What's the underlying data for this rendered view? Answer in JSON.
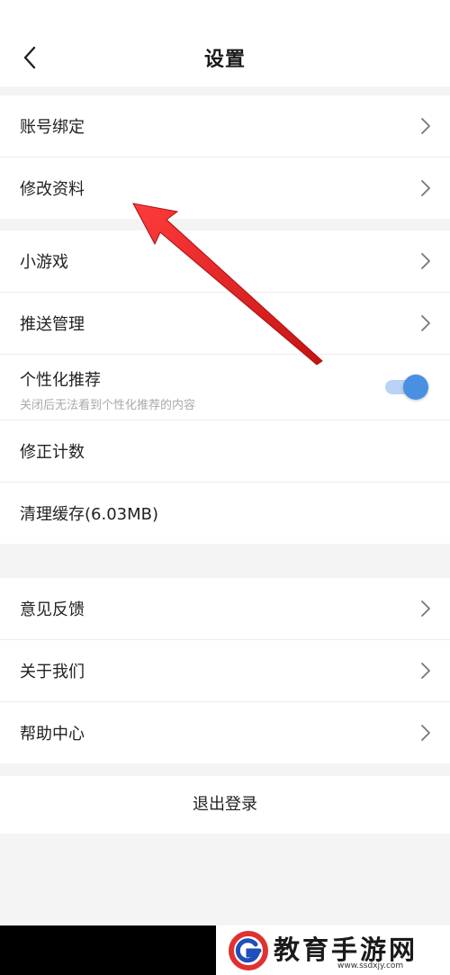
{
  "header": {
    "title": "设置"
  },
  "group1": [
    {
      "label": "账号绑定"
    },
    {
      "label": "修改资料"
    }
  ],
  "group2": {
    "mini_games": "小游戏",
    "push": "推送管理",
    "personalized": {
      "title": "个性化推荐",
      "subtitle": "关闭后无法看到个性化推荐的内容",
      "enabled": true
    },
    "correct_count": "修正计数",
    "clear_cache": "清理缓存(6.03MB)"
  },
  "group3": [
    {
      "label": "意见反馈"
    },
    {
      "label": "关于我们"
    },
    {
      "label": "帮助中心"
    }
  ],
  "logout": "退出登录",
  "colors": {
    "toggle_accent": "#4a90e2",
    "annotation_arrow": "#e02020"
  },
  "watermark": {
    "brand": "教育手游网",
    "url": "www.ssdxjy.com"
  }
}
